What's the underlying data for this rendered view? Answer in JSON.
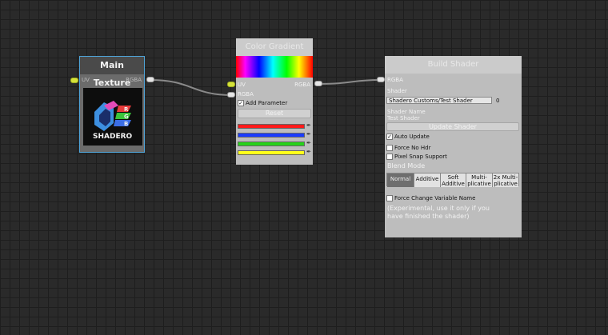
{
  "main_texture": {
    "title": "Main Texture",
    "port_in": "UV",
    "port_out": "RGBA",
    "logo_letters": [
      "R",
      "G",
      "B"
    ],
    "logo_name": "SHADERO"
  },
  "color_gradient": {
    "title": "Color Gradient",
    "port_uv": "UV",
    "port_out": "RGBA",
    "port_rgba": "RGBA",
    "add_parameter": "Add Parameter",
    "reset": "Reset",
    "swatches": [
      "#ff1a1a",
      "#1a3cff",
      "#27d21b",
      "#ffff1a"
    ],
    "picker_icon": "✒"
  },
  "build_shader": {
    "title": "Build Shader",
    "port_in": "RGBA",
    "shader_label": "Shader",
    "shader_path": "Shadero Customs/Test Shader",
    "shader_index": "0",
    "shader_name_label": "Shader Name",
    "shader_name_value": "Test Shader",
    "update_button": "Update Shader",
    "auto_update": "Auto Update",
    "force_no_hdr": "Force No Hdr",
    "pixel_snap": "Pixel Snap Support",
    "blend_mode": "Blend Mode",
    "blend_options": [
      "Normal",
      "Additive",
      "Soft Additive",
      "Multi-plicative",
      "2x Multi-plicative"
    ],
    "force_change": "Force Change Variable Name",
    "experimental": "(Experimental, use it only if you have finished the shader)"
  }
}
